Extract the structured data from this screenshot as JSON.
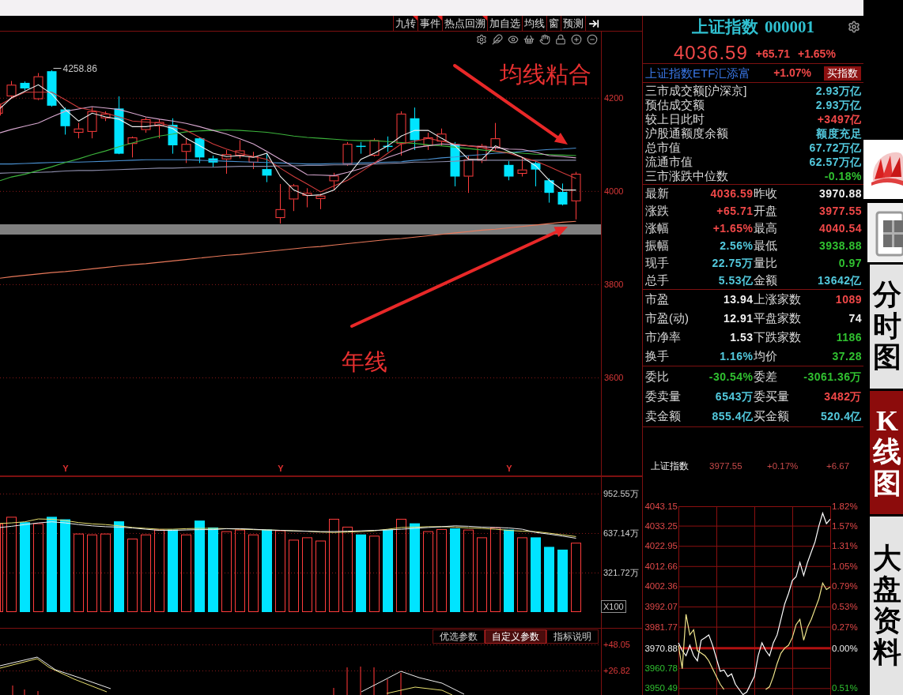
{
  "toolbar": {
    "tabs": [
      {
        "label": "九转",
        "flagged": true
      },
      {
        "label": "事件",
        "flagged": true
      },
      {
        "label": "热点回溯",
        "flagged": true
      },
      {
        "label": "加自选",
        "flagged": false
      },
      {
        "label": "均线",
        "flagged": false
      },
      {
        "label": "窗",
        "flagged": false
      },
      {
        "label": "预测",
        "flagged": false
      }
    ]
  },
  "kline": {
    "high_label": "4258.86",
    "year_markers": [
      "Y",
      "Y",
      "Y"
    ],
    "annotations": [
      "均线粘合",
      "年线"
    ],
    "chart_data": {
      "type": "candlestick",
      "grid": true,
      "categories": [
        null,
        null,
        null,
        null,
        null,
        null,
        null,
        null,
        null,
        null,
        null,
        null,
        null,
        null,
        null,
        null,
        null,
        null,
        null,
        null,
        null,
        null,
        null,
        null,
        null,
        null,
        null,
        null,
        null,
        null,
        null,
        null,
        null,
        null,
        null,
        null,
        null,
        null,
        null,
        null,
        null,
        null,
        null,
        null
      ],
      "ylim": [
        3388,
        4342
      ],
      "yticks": [
        {
          "value": 4200,
          "label": "4200"
        },
        {
          "value": 4000,
          "label": "4000"
        },
        {
          "value": 3800,
          "label": "3800"
        },
        {
          "value": 3600,
          "label": "3600"
        }
      ],
      "ohlc": [
        [
          4166,
          4187,
          4162,
          4183
        ],
        [
          4203,
          4236,
          4199,
          4228
        ],
        [
          4232,
          4235,
          4216,
          4220
        ],
        [
          4197,
          4253,
          4195,
          4246
        ],
        [
          4257,
          4259,
          4181,
          4183
        ],
        [
          4175,
          4179,
          4121,
          4139
        ],
        [
          4125,
          4146,
          4113,
          4134
        ],
        [
          4127,
          4179,
          4113,
          4171
        ],
        [
          4156,
          4171,
          4150,
          4166
        ],
        [
          4177,
          4203,
          4079,
          4080
        ],
        [
          4101,
          4117,
          4072,
          4115
        ],
        [
          4131,
          4158,
          4125,
          4154
        ],
        [
          4139,
          4154,
          4113,
          4148
        ],
        [
          4142,
          4156,
          4080,
          4098
        ],
        [
          4084,
          4113,
          4060,
          4101
        ],
        [
          4113,
          4115,
          4060,
          4072
        ],
        [
          4070,
          4076,
          4051,
          4061
        ],
        [
          4068,
          4088,
          4037,
          4079
        ],
        [
          4076,
          4109,
          4070,
          4087
        ],
        [
          4061,
          4084,
          4047,
          4074
        ],
        [
          4047,
          4080,
          4019,
          4033
        ],
        [
          3942,
          4015,
          3930,
          3961
        ],
        [
          3982,
          4015,
          3957,
          4012
        ],
        [
          3990,
          4006,
          3965,
          3996
        ],
        [
          3983,
          3994,
          3961,
          3990
        ],
        [
          4021,
          4039,
          4002,
          4033
        ],
        [
          4057,
          4105,
          4054,
          4101
        ],
        [
          4097,
          4105,
          4080,
          4095
        ],
        [
          4076,
          4113,
          4074,
          4109
        ],
        [
          4097,
          4117,
          4084,
          4095
        ],
        [
          4101,
          4171,
          4076,
          4166
        ],
        [
          4156,
          4179,
          4088,
          4109
        ],
        [
          4097,
          4125,
          4088,
          4115
        ],
        [
          4106,
          4134,
          4097,
          4123
        ],
        [
          4101,
          4105,
          4010,
          4031
        ],
        [
          4031,
          4076,
          3996,
          4068
        ],
        [
          4065,
          4101,
          4060,
          4097
        ],
        [
          4093,
          4146,
          4088,
          4113
        ],
        [
          4056,
          4064,
          4023,
          4031
        ],
        [
          4037,
          4072,
          4031,
          4046
        ],
        [
          4060,
          4064,
          4010,
          4046
        ],
        [
          4023,
          4027,
          3975,
          3996
        ],
        [
          3998,
          4016,
          3969,
          3971
        ],
        [
          3978,
          4041,
          3939,
          4037
        ]
      ],
      "series": [
        {
          "type": "line",
          "color": "#8a8aa8",
          "values": [
            4038,
            4039,
            4039,
            4040,
            4041,
            4043,
            4044,
            4044,
            4045,
            4046,
            4047,
            4048,
            4049,
            4049,
            4050,
            4051,
            4051,
            4052,
            4053,
            4053,
            4053,
            4054,
            4054,
            4055,
            4055,
            4056,
            4056,
            4057,
            4058,
            4059,
            4060,
            4062,
            4062,
            4063,
            4064,
            4066,
            4066,
            4066,
            4066,
            4066,
            4066,
            4066,
            4066,
            4066
          ]
        },
        {
          "type": "line",
          "color": "#4a90d0",
          "values": [
            4058,
            4058,
            4059,
            4060,
            4061,
            4062,
            4062,
            4063,
            4064,
            4065,
            4066,
            4067,
            4067,
            4067,
            4067,
            4066,
            4065,
            4064,
            4063,
            4062,
            4061,
            4060,
            4059,
            4058,
            4058,
            4059,
            4059,
            4060,
            4061,
            4062,
            4063,
            4066,
            4068,
            4071,
            4073,
            4076,
            4078,
            4081,
            4082,
            4085,
            4087,
            4089,
            4090,
            4092
          ]
        },
        {
          "type": "line",
          "color": "#3cb43c",
          "values": [
            4022,
            4030,
            4036,
            4044,
            4052,
            4061,
            4069,
            4078,
            4086,
            4095,
            4103,
            4111,
            4118,
            4122,
            4127,
            4129,
            4130,
            4131,
            4130,
            4128,
            4126,
            4122,
            4118,
            4115,
            4113,
            4111,
            4109,
            4108,
            4108,
            4106,
            4104,
            4102,
            4099,
            4097,
            4094,
            4091,
            4088,
            4085,
            4083,
            4081,
            4079,
            4078,
            4077,
            4076
          ]
        },
        {
          "type": "line",
          "color": "#d8a8d0",
          "values": [
            4125,
            4132,
            4139,
            4146,
            4159,
            4171,
            4176,
            4181,
            4178,
            4175,
            4167,
            4159,
            4154,
            4150,
            4145,
            4138,
            4130,
            4122,
            4112,
            4101,
            4085,
            4068,
            4052,
            4035,
            4034,
            4033,
            4040,
            4048,
            4060,
            4072,
            4082,
            4093,
            4097,
            4101,
            4099,
            4097,
            4095,
            4093,
            4090,
            4089,
            4083,
            4076,
            4074,
            4071
          ]
        },
        {
          "type": "line",
          "color": "#d03c3c",
          "values": [
            4185,
            4199,
            4212,
            4212,
            4212,
            4196,
            4179,
            4173,
            4167,
            4159,
            4150,
            4148,
            4146,
            4138,
            4130,
            4115,
            4101,
            4090,
            4081,
            4074,
            4068,
            4049,
            4031,
            4015,
            3998,
            4011,
            4023,
            4041,
            4060,
            4081,
            4101,
            4107,
            4113,
            4107,
            4101,
            4097,
            4093,
            4086,
            4081,
            4072,
            4064,
            4052,
            4039,
            4027
          ]
        },
        {
          "type": "line",
          "color": "#f0f0f0",
          "values": [
            4177,
            4200,
            4214,
            4228,
            4208,
            4175,
            4150,
            4167,
            4159,
            4154,
            4138,
            4138,
            4142,
            4134,
            4113,
            4097,
            4081,
            4074,
            4076,
            4072,
            4081,
            4031,
            4002,
            3990,
            3992,
            4002,
            4031,
            4068,
            4081,
            4097,
            4118,
            4130,
            4130,
            4113,
            4097,
            4068,
            4068,
            4097,
            4085,
            4072,
            4054,
            4023,
            4002,
            4002
          ]
        },
        {
          "type": "line",
          "color": "#e8785a",
          "values": [
            3813,
            3816,
            3819,
            3822,
            3825,
            3827,
            3830,
            3833,
            3836,
            3839,
            3842,
            3844,
            3847,
            3850,
            3853,
            3856,
            3859,
            3862,
            3864,
            3867,
            3870,
            3873,
            3876,
            3879,
            3881,
            3884,
            3887,
            3890,
            3893,
            3896,
            3898,
            3901,
            3904,
            3907,
            3910,
            3913,
            3916,
            3918,
            3921,
            3924,
            3927,
            3930,
            3933,
            3935
          ]
        }
      ]
    }
  },
  "volume": {
    "unit_label": "X100",
    "chart_data": {
      "type": "bar",
      "stacked": true,
      "grid": true,
      "categories": [
        null,
        null,
        null,
        null,
        null,
        null,
        null,
        null,
        null,
        null,
        null,
        null,
        null,
        null,
        null,
        null,
        null,
        null,
        null,
        null,
        null,
        null,
        null,
        null,
        null,
        null,
        null,
        null,
        null,
        null,
        null,
        null,
        null,
        null,
        null,
        null,
        null,
        null,
        null,
        null,
        null,
        null,
        null,
        null
      ],
      "ylim": [
        0,
        1091
      ],
      "yticks": [
        {
          "value": 952.55,
          "label": "952.55万"
        },
        {
          "value": 637.14,
          "label": "637.14万"
        },
        {
          "value": 321.72,
          "label": "321.72万"
        }
      ],
      "series": [
        {
          "color": "#ff3c3c",
          "values": [
            714,
            767,
            null,
            715,
            null,
            null,
            633,
            626,
            633,
            null,
            593,
            626,
            665,
            null,
            626,
            null,
            null,
            652,
            665,
            626,
            null,
            659,
            584,
            603,
            577,
            751,
            688,
            null,
            616,
            null,
            751,
            null,
            652,
            669,
            null,
            665,
            603,
            682,
            null,
            603,
            null,
            null,
            null,
            560
          ]
        },
        {
          "color": "#00e4ff",
          "values": [
            null,
            null,
            724,
            null,
            767,
            747,
            null,
            null,
            null,
            731,
            null,
            null,
            null,
            665,
            null,
            737,
            682,
            null,
            null,
            null,
            665,
            null,
            null,
            null,
            null,
            null,
            null,
            626,
            null,
            665,
            null,
            715,
            null,
            null,
            675,
            null,
            null,
            null,
            665,
            null,
            603,
            527,
            505,
            null
          ]
        },
        {
          "type": "line",
          "color": "#e8e070",
          "values": [
            714,
            718,
            727,
            750,
            747,
            737,
            721,
            711,
            705,
            695,
            682,
            675,
            668,
            668,
            672,
            675,
            675,
            672,
            668,
            665,
            662,
            659,
            655,
            652,
            645,
            642,
            645,
            649,
            655,
            668,
            682,
            685,
            688,
            688,
            685,
            678,
            675,
            668,
            659,
            652,
            649,
            636,
            623,
            609
          ]
        },
        {
          "type": "line",
          "color": "#f0f0f0",
          "values": [
            682,
            691,
            705,
            718,
            727,
            718,
            705,
            695,
            688,
            685,
            678,
            668,
            659,
            659,
            662,
            665,
            665,
            672,
            672,
            668,
            662,
            659,
            655,
            652,
            649,
            649,
            652,
            655,
            659,
            662,
            668,
            675,
            682,
            688,
            695,
            691,
            685,
            682,
            678,
            668,
            642,
            629,
            613,
            596
          ]
        }
      ]
    }
  },
  "indicator": {
    "buttons": [
      {
        "label": "优选参数",
        "selected": false
      },
      {
        "label": "自定义参数",
        "selected": true
      },
      {
        "label": "指标说明",
        "selected": false
      }
    ],
    "axis_labels": [
      "+48.05",
      "+26.82"
    ]
  },
  "quote_panel": {
    "name": "上证指数",
    "code": "000001",
    "price": "4036.59",
    "change": "+65.71",
    "change_pct": "+1.65%",
    "etf": {
      "name": "上证指数ETF汇添富",
      "change": "+1.07%",
      "button": "买指数"
    },
    "market_info": [
      {
        "label": "三市成交额[沪深京]",
        "value": "2.93万亿",
        "color": "#52c8dc"
      },
      {
        "label": "预估成交额",
        "value": "2.93万亿",
        "color": "#52c8dc"
      },
      {
        "label": "较上日此时",
        "value": "+3497亿",
        "color": "#f04848"
      },
      {
        "label": "沪股通额度余额",
        "value": "额度充足",
        "color": "#52c8dc"
      },
      {
        "label": "总市值",
        "value": "67.72万亿",
        "color": "#52c8dc"
      },
      {
        "label": "流通市值",
        "value": "62.57万亿",
        "color": "#52c8dc"
      },
      {
        "label": "三市涨跌中位数",
        "value": "-0.18%",
        "color": "#30c030"
      }
    ],
    "blocks": [
      {
        "rows": [
          [
            {
              "label": "最新",
              "value": "4036.59",
              "color": "#f04848"
            },
            {
              "label": "昨收",
              "value": "3970.88",
              "color": "#f0f0f0"
            }
          ],
          [
            {
              "label": "涨跌",
              "value": "+65.71",
              "color": "#f04848"
            },
            {
              "label": "开盘",
              "value": "3977.55",
              "color": "#f04848"
            }
          ],
          [
            {
              "label": "涨幅",
              "value": "+1.65%",
              "color": "#f04848"
            },
            {
              "label": "最高",
              "value": "4040.54",
              "color": "#f04848"
            }
          ],
          [
            {
              "label": "振幅",
              "value": "2.56%",
              "color": "#52c8dc"
            },
            {
              "label": "最低",
              "value": "3938.88",
              "color": "#30c030"
            }
          ],
          [
            {
              "label": "现手",
              "value": "22.75万",
              "color": "#52c8dc"
            },
            {
              "label": "量比",
              "value": "0.97",
              "color": "#30c030"
            }
          ],
          [
            {
              "label": "总手",
              "value": "5.53亿",
              "color": "#52c8dc"
            },
            {
              "label": "金额",
              "value": "13642亿",
              "color": "#52c8dc"
            }
          ]
        ]
      },
      {
        "rows": [
          [
            {
              "label": "市盈",
              "value": "13.94",
              "color": "#f0f0f0"
            },
            {
              "label": "上涨家数",
              "value": "1089",
              "color": "#f04848"
            }
          ],
          [
            {
              "label": "市盈(动)",
              "value": "12.91",
              "color": "#f0f0f0"
            },
            {
              "label": "平盘家数",
              "value": "74",
              "color": "#f0f0f0"
            }
          ],
          [
            {
              "label": "市净率",
              "value": "1.53",
              "color": "#f0f0f0"
            },
            {
              "label": "下跌家数",
              "value": "1186",
              "color": "#30c030"
            }
          ],
          [
            {
              "label": "换手",
              "value": "1.16%",
              "color": "#52c8dc"
            },
            {
              "label": "均价",
              "value": "37.28",
              "color": "#30c030"
            }
          ]
        ]
      },
      {
        "rows": [
          [
            {
              "label": "委比",
              "value": "-30.54%",
              "color": "#30c030"
            },
            {
              "label": "委差",
              "value": "-3061.36万",
              "color": "#30c030"
            }
          ],
          [
            {
              "label": "委卖量",
              "value": "6543万",
              "color": "#52c8dc"
            },
            {
              "label": "委买量",
              "value": "3482万",
              "color": "#f04848"
            }
          ],
          [
            {
              "label": "卖金额",
              "value": "855.4亿",
              "color": "#52c8dc"
            },
            {
              "label": "买金额",
              "value": "520.4亿",
              "color": "#52c8dc"
            }
          ]
        ]
      }
    ]
  },
  "intraday": {
    "title": "上证指数",
    "price": "3977.55",
    "change_pct": "+0.17%",
    "change": "+6.67",
    "chart_data": {
      "type": "line",
      "grid": true,
      "categories": [
        null,
        null,
        null,
        null,
        null,
        null,
        null,
        null,
        null,
        null,
        null,
        null,
        null,
        null,
        null,
        null,
        null,
        null,
        null,
        null,
        null,
        null,
        null,
        null,
        null,
        null,
        null,
        null,
        null,
        null,
        null,
        null,
        null,
        null,
        null,
        null,
        null,
        null,
        null,
        null,
        null
      ],
      "ylim": [
        3947,
        4043.15
      ],
      "yticks": [
        {
          "value": 4043.15,
          "label": "4043.15"
        },
        {
          "value": 4033.25,
          "label": "4033.25"
        },
        {
          "value": 4022.95,
          "label": "4022.95"
        },
        {
          "value": 4012.66,
          "label": "4012.66"
        },
        {
          "value": 4002.36,
          "label": "4002.36"
        },
        {
          "value": 3992.07,
          "label": "3992.07"
        },
        {
          "value": 3981.77,
          "label": "3981.77"
        },
        {
          "value": 3970.88,
          "label": "3970.88"
        },
        {
          "value": 3960.78,
          "label": "3960.78"
        },
        {
          "value": 3950.49,
          "label": "3950.49"
        }
      ],
      "ref_lines": [
        {
          "axis": "y",
          "value": 3970.88
        }
      ],
      "annotations": [
        "1.82%",
        "1.57%",
        "1.31%",
        "1.05%",
        "0.79%",
        "0.53%",
        "0.27%",
        "0.00%",
        "0.51%"
      ],
      "series": [
        {
          "color": "#ffffff",
          "values": [
            3973.6,
            3969.6,
            3967.0,
            3972.3,
            3967.0,
            3964.4,
            3974.9,
            3976.2,
            3977.6,
            3972.3,
            3965.7,
            3959.1,
            3959.7,
            3956.4,
            3957.8,
            3952.5,
            3949.8,
            3947.2,
            3948.5,
            3952.5,
            3956.4,
            3967.0,
            3973.6,
            3969.6,
            3967.0,
            3973.6,
            3977.6,
            3985.5,
            3993.4,
            3998.7,
            4005.3,
            4007.3,
            4014.5,
            4007.9,
            4014.5,
            4019.8,
            4025.1,
            4033.0,
            4039.6,
            4034.3,
            4036.6
          ]
        },
        {
          "color": "#f0e68c",
          "values": [
            3972.3,
            3960.4,
            3988.1,
            3977.6,
            3980.2,
            3969.6,
            3968.3,
            3967.0,
            3964.4,
            3960.4,
            3956.4,
            3952.5,
            3949.8,
            null,
            null,
            null,
            null,
            null,
            null,
            null,
            null,
            null,
            null,
            3949.8,
            3951.2,
            3956.4,
            3963.0,
            3968.3,
            3970.9,
            3972.3,
            3976.2,
            3982.8,
            3985.5,
            3974.9,
            3981.5,
            3985.5,
            3990.8,
            3996.0,
            4004.0,
            4000.7,
            4002.0
          ]
        }
      ]
    }
  },
  "side_tabs": [
    {
      "label": "分时图",
      "selected": false
    },
    {
      "label": "K线图",
      "selected": true
    },
    {
      "label": "大盘资料",
      "selected": false
    }
  ]
}
